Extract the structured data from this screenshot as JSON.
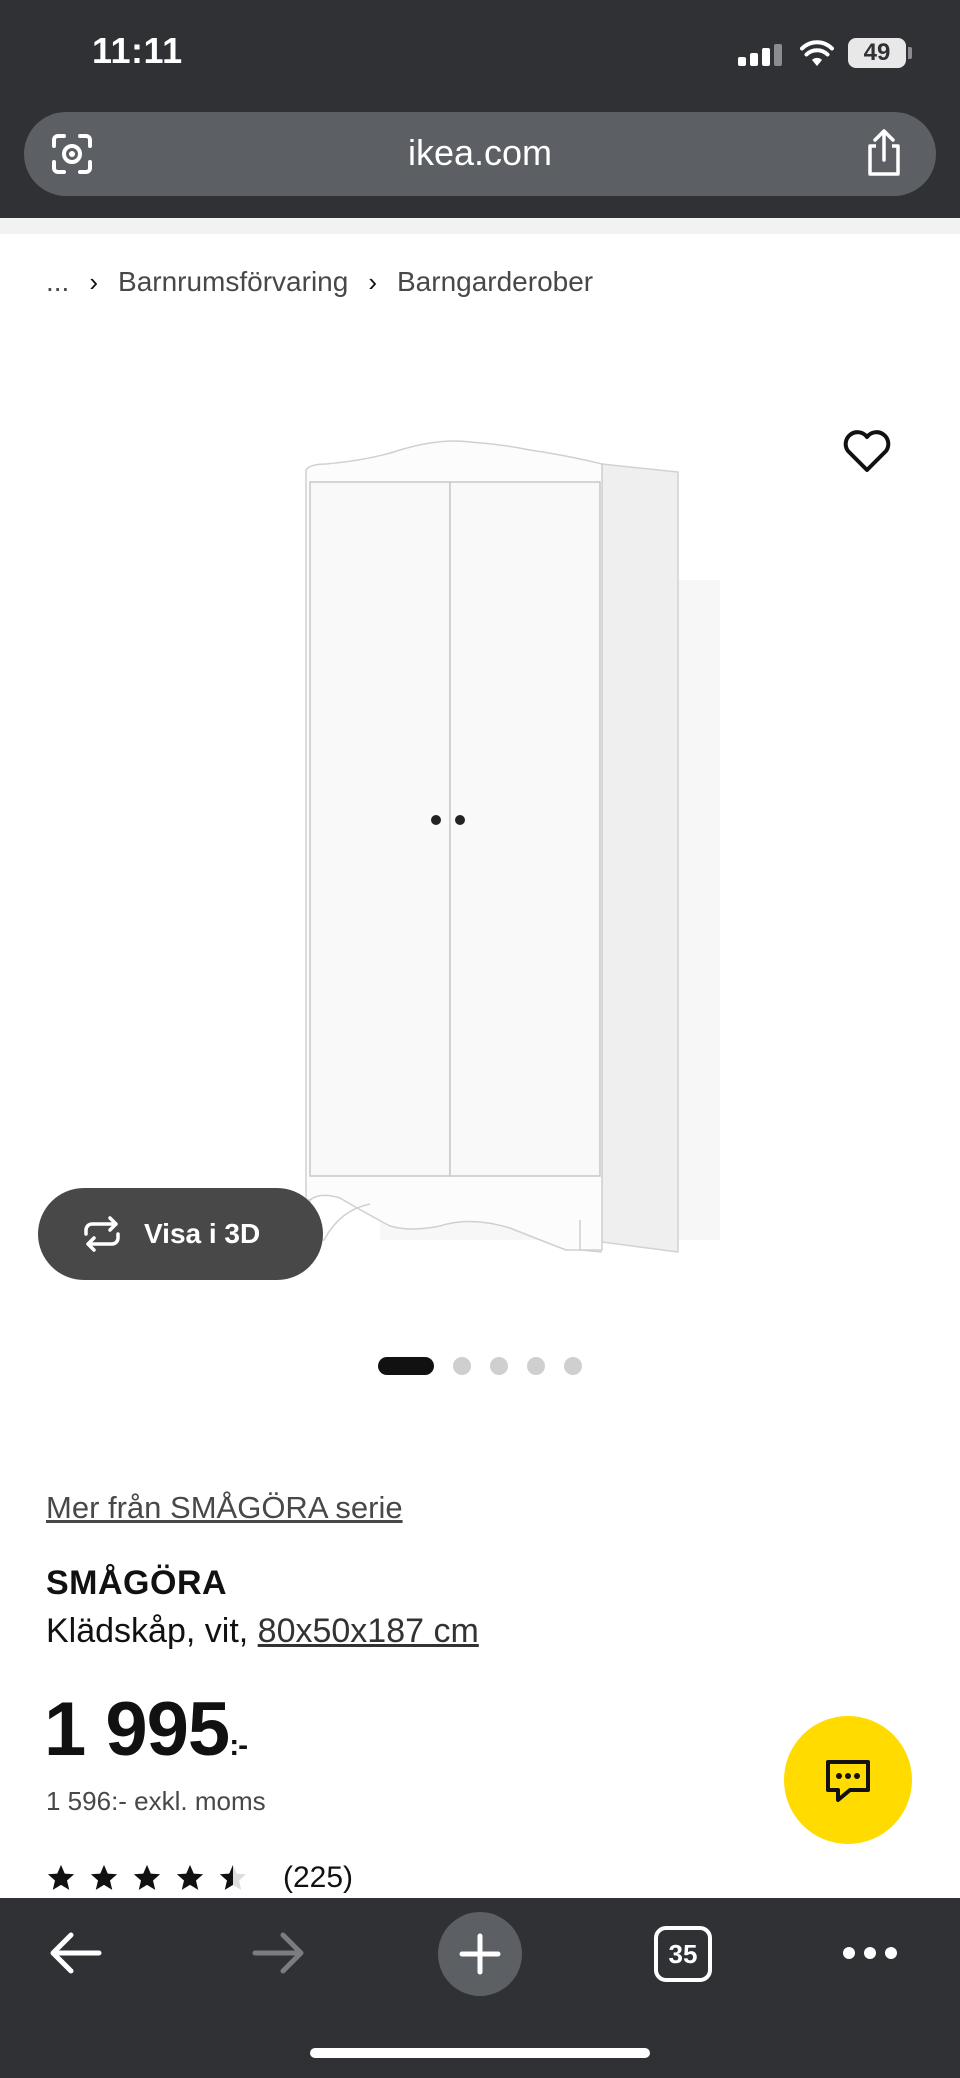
{
  "status_bar": {
    "time": "11:11",
    "battery": "49"
  },
  "browser": {
    "url": "ikea.com",
    "tab_count": "35"
  },
  "breadcrumb": {
    "ellipsis": "...",
    "items": [
      "Barnrumsförvaring",
      "Barngarderober"
    ]
  },
  "gallery": {
    "view_3d_label": "Visa i 3D",
    "image_count": 5,
    "active_index": 0
  },
  "product": {
    "series_link": "Mer från SMÅGÖRA serie",
    "name": "SMÅGÖRA",
    "description": "Klädskåp, vit,",
    "dimensions": "80x50x187 cm",
    "price": "1 995",
    "price_suffix": ":-",
    "price_excl_vat": "1 596:- exkl. moms",
    "rating": 4.5,
    "rating_max": 5,
    "review_count": "(225)"
  },
  "colors": {
    "chrome": "#2f3135",
    "chat_fab": "#ffdb00",
    "text": "#111111"
  },
  "icons": {
    "lens": "visual-search-icon",
    "share": "share-icon",
    "favorite": "heart-icon",
    "rotate": "rotate-3d-icon",
    "chat": "chat-icon",
    "back": "arrow-left-icon",
    "forward": "arrow-right-icon",
    "new_tab": "plus-icon",
    "more": "more-dots-icon"
  }
}
